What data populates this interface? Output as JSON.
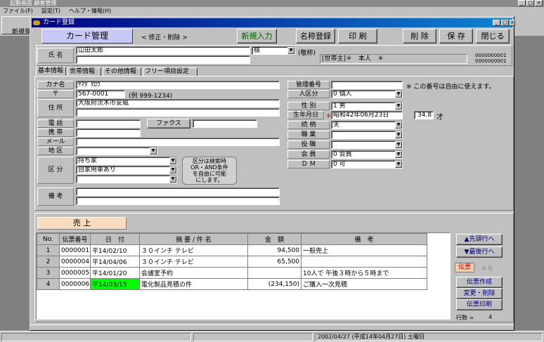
{
  "app": {
    "title": "起動画面 顧客管理",
    "menu": [
      "ファイル(F)",
      "設定(T)",
      "ヘルプ・情報(H)"
    ],
    "toolbar_new": "新規登",
    "win_controls": [
      "_",
      "□",
      "×"
    ]
  },
  "dialog": {
    "title": "カード登録",
    "win_controls": [
      "_",
      "□",
      "×"
    ],
    "header": {
      "card_mgmt": "カード管理",
      "mode": "< 修正・削除 >",
      "new_entry": "新規入力",
      "name_reg": "名称登録",
      "print": "印 刷",
      "delete": "削 除",
      "save": "保 存",
      "close": "閉じる"
    },
    "name_row": {
      "label": "氏 名",
      "value": "山田太郎",
      "honorific": "様",
      "honorific_label": "(敬称)",
      "household": "[世帯主]＊　本人　＊",
      "id1": "0000000001",
      "id2": "0000000001"
    },
    "tabs": [
      "基本情報",
      "世帯情報",
      "その他情報",
      "フリー項目設定"
    ],
    "basic": {
      "kana_label": "カナ名",
      "kana": "ﾔﾏﾀﾞﾀﾛｳ",
      "zip_label": "〒",
      "zip": "567-0001",
      "zip_example": "(例 999-1234)",
      "address_label": "住 所",
      "address": "大阪府茨木市安威",
      "phone_label": "電 話",
      "fax_btn": "ファクス",
      "mobile_label": "携 帯",
      "mail_label": "メール",
      "area_label": "地 区",
      "category_label": "区 分",
      "categories": [
        "持ち家",
        "自家用車あり",
        ""
      ],
      "category_note": "区分は検索時\nOR・AND条件\nを自由に可能\nにします。",
      "note_label": "備 考"
    },
    "right": {
      "mgmt_no_label": "管理番号",
      "mgmt_note": "※ この番号は自由に使えます。",
      "person_type_label": "人区分",
      "person_type": "0 個人",
      "gender_label": "性 別",
      "gender": "1 男",
      "birth_label": "生年月日",
      "birth_mark": "＊",
      "birth": "昭和42年06月23日",
      "age": "34.8",
      "age_unit": "才",
      "relation_label": "続 柄",
      "relation": "夫",
      "job_label": "職 業",
      "job": "",
      "position_label": "役 職",
      "position": "",
      "member_label": "会 員",
      "member": "0 会員",
      "dm_label": "Ｄ Ｍ",
      "dm": "0 可"
    },
    "sales": {
      "tab": "売 上",
      "headers": [
        "No.",
        "伝票番号",
        "日　付",
        "摘 要 / 件 名",
        "金　額",
        "備　考"
      ],
      "rows": [
        {
          "no": "1",
          "slip": "0000001",
          "date": "平14/02/10",
          "summary": "３０インチ テレビ",
          "amount": "94,500",
          "note": "一般売上"
        },
        {
          "no": "2",
          "slip": "0000004",
          "date": "平14/04/06",
          "summary": "３０インチ テレビ",
          "amount": "65,500",
          "note": ""
        },
        {
          "no": "3",
          "slip": "0000005",
          "date": "平14/01/20",
          "summary": "会議室予約",
          "amount": "",
          "note": "10人で 午後３時から５時まで"
        },
        {
          "no": "4",
          "slip": "0000006",
          "date": "平14/03/15",
          "summary": "電化製品見積の件",
          "amount": "(234,150)",
          "note": "ご購入一次見積"
        }
      ],
      "first_row": "▲先頭行へ",
      "last_row": "▼最後行へ",
      "slip_tab": "伝票",
      "memo_tab": "メモ",
      "create": "伝票作成",
      "edit": "変更・削除",
      "print": "伝票印刷",
      "row_count_label": "行数 =",
      "row_count": "4"
    }
  },
  "status": {
    "date": "2002/04/27 (平成14年04月27日) 土曜日"
  },
  "colors": {
    "title_gradient": "#000080",
    "highlight": "#00ff00",
    "panel": "#c0c0c0"
  }
}
